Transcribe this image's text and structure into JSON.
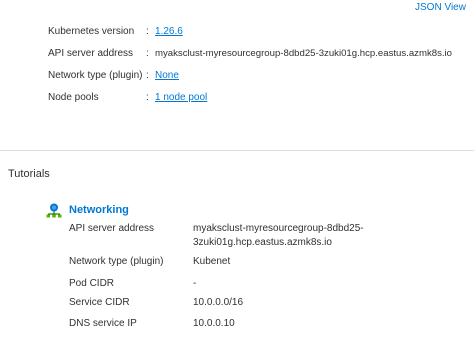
{
  "overview": {
    "json_view": "JSON View",
    "rows": [
      {
        "label": "Kubernetes version",
        "sep": ":",
        "value": "1.26.6",
        "is_link": true
      },
      {
        "label": "API server address",
        "sep": ":",
        "value": "myaksclust-myresourcegroup-8dbd25-3zuki01g.hcp.eastus.azmk8s.io",
        "is_link": false
      },
      {
        "label": "Network type (plugin)",
        "sep": ":",
        "value": "None",
        "is_link": true
      },
      {
        "label": "Node pools",
        "sep": ":",
        "value": "1 node pool",
        "is_link": true
      }
    ]
  },
  "tutorials": {
    "title": "Tutorials",
    "networking": {
      "title": "Networking",
      "icon": "networking-icon",
      "rows": [
        {
          "label": "API server address",
          "value_line1": "myaksclust-myresourcegroup-8dbd25-",
          "value_line2": "3zuki01g.hcp.eastus.azmk8s.io"
        },
        {
          "label": "Network type (plugin)",
          "value": "Kubenet"
        },
        {
          "label": "Pod CIDR",
          "value": "-"
        },
        {
          "label": "Service CIDR",
          "value": "10.0.0.0/16"
        },
        {
          "label": "DNS service IP",
          "value": "10.0.0.10"
        }
      ]
    }
  },
  "colors": {
    "link": "#0078d4",
    "text": "#323130",
    "divider": "#e1dfdd"
  }
}
